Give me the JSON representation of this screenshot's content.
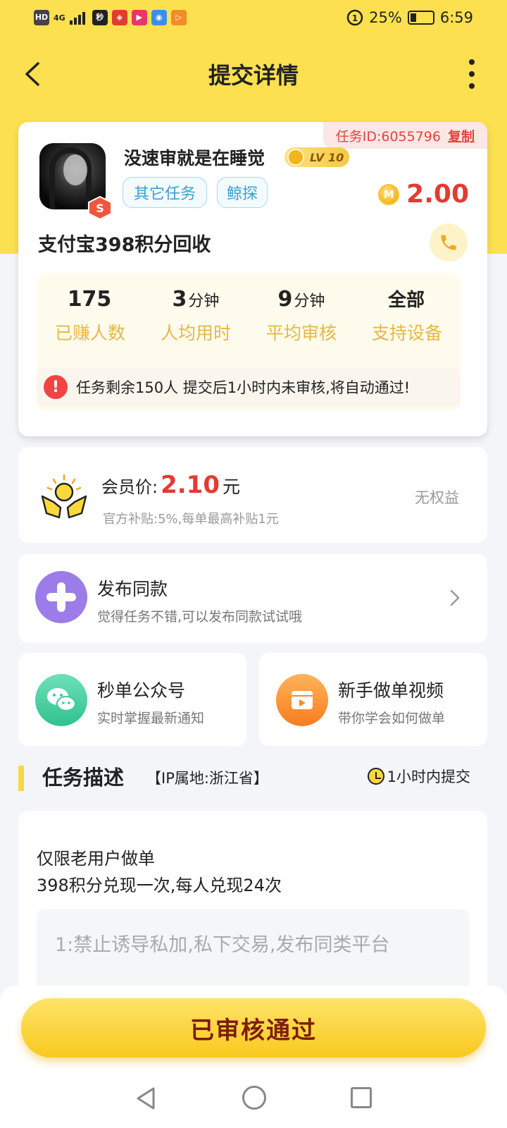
{
  "status_bar": {
    "network": "4G",
    "battery_percent": "25%",
    "time": "6:59"
  },
  "header": {
    "title": "提交详情"
  },
  "task": {
    "task_id_label": "任务ID:6055796",
    "copy_label": "复制",
    "username": "没速审就是在睡觉",
    "level": "LV 10",
    "tags": [
      "其它任务",
      "鲸探"
    ],
    "reward": "2.00",
    "title": "支付宝398积分回收",
    "stats": [
      {
        "value": "175",
        "unit": "",
        "label": "已赚人数"
      },
      {
        "value": "3",
        "unit": "分钟",
        "label": "人均用时"
      },
      {
        "value": "9",
        "unit": "分钟",
        "label": "平均审核"
      },
      {
        "value": "全部",
        "unit": "",
        "label": "支持设备"
      }
    ],
    "notice": "任务剩余150人  提交后1小时内未审核,将自动通过!"
  },
  "vip": {
    "label": "会员价:",
    "price": "2.10",
    "unit": "元",
    "desc": "官方补贴:5%,每单最高补贴1元",
    "right_text": "无权益"
  },
  "publish": {
    "title": "发布同款",
    "subtitle": "觉得任务不错,可以发布同款试试哦"
  },
  "wechat": {
    "title": "秒单公众号",
    "subtitle": "实时掌握最新通知"
  },
  "video": {
    "title": "新手做单视频",
    "subtitle": "带你学会如何做单"
  },
  "section": {
    "title": "任务描述",
    "ip": "【IP属地:浙江省】",
    "time": "1小时内提交"
  },
  "description": {
    "line1": "仅限老用户做单",
    "line2": "398积分兑现一次,每人兑现24次",
    "rule": "1:禁止诱导私加,私下交易,发布同类平台"
  },
  "bottom": {
    "button": "已审核通过"
  },
  "colors": {
    "brand_yellow": "#fde050",
    "price_red": "#e23b33",
    "stat_label": "#e6b844"
  }
}
